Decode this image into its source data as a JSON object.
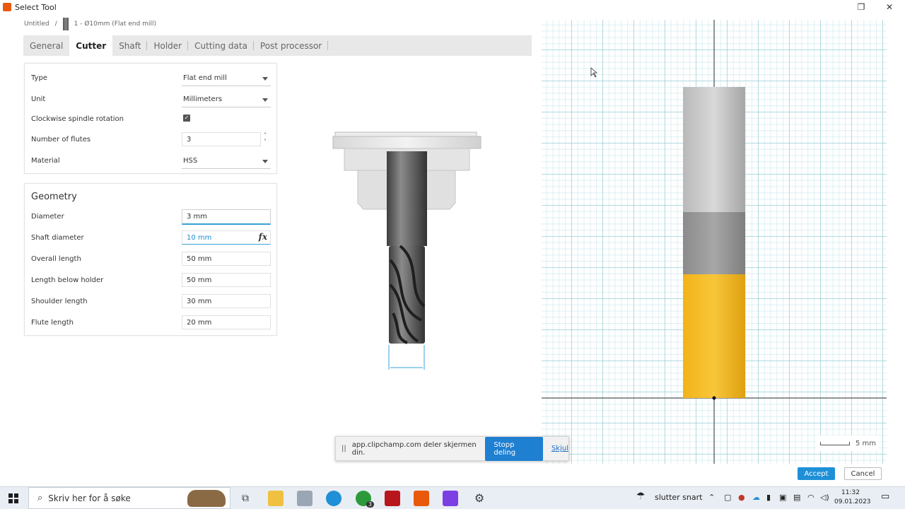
{
  "window": {
    "title": "Select Tool",
    "controls": {
      "restore": "❐",
      "close": "✕"
    }
  },
  "breadcrumb": {
    "document": "Untitled",
    "separator": "/",
    "tool": "1 - Ø10mm (Flat end mill)"
  },
  "tabs": [
    {
      "label": "General",
      "active": false
    },
    {
      "label": "Cutter",
      "active": true
    },
    {
      "label": "Shaft",
      "active": false
    },
    {
      "label": "Holder",
      "active": false
    },
    {
      "label": "Cutting data",
      "active": false
    },
    {
      "label": "Post processor",
      "active": false
    }
  ],
  "cutter": {
    "type_label": "Type",
    "type_value": "Flat end mill",
    "unit_label": "Unit",
    "unit_value": "Millimeters",
    "clockwise_label": "Clockwise spindle rotation",
    "clockwise_checked": true,
    "flutes_label": "Number of flutes",
    "flutes_value": "3",
    "material_label": "Material",
    "material_value": "HSS"
  },
  "geometry": {
    "title": "Geometry",
    "diameter_label": "Diameter",
    "diameter_value": "3 mm",
    "shaft_diameter_label": "Shaft diameter",
    "shaft_diameter_value": "10 mm",
    "fx": "fx",
    "overall_length_label": "Overall length",
    "overall_length_value": "50 mm",
    "length_below_holder_label": "Length below holder",
    "length_below_holder_value": "50 mm",
    "shoulder_length_label": "Shoulder length",
    "shoulder_length_value": "30 mm",
    "flute_length_label": "Flute length",
    "flute_length_value": "20 mm"
  },
  "viewport": {
    "scale_label": "5 mm",
    "colors": {
      "holder": "#c9c9c9",
      "shaft": "#9a9a9a",
      "flute": "#f2b318"
    }
  },
  "buttons": {
    "accept": "Accept",
    "cancel": "Cancel"
  },
  "share_bar": {
    "pause_icon": "||",
    "message": "app.clipchamp.com deler skjermen din.",
    "stop_label": "Stopp deling",
    "hide_label": "Skjul"
  },
  "taskbar": {
    "search_placeholder": "Skriv her for å søke",
    "weather": "slutter snart",
    "time": "11:32",
    "date": "09.01.2023",
    "xbox_badge": "3",
    "colors": {
      "edge": "#1f8fd6",
      "xbox": "#2c9a3a",
      "fusion": "#e8590c",
      "clipchamp": "#7b3fe4"
    }
  }
}
